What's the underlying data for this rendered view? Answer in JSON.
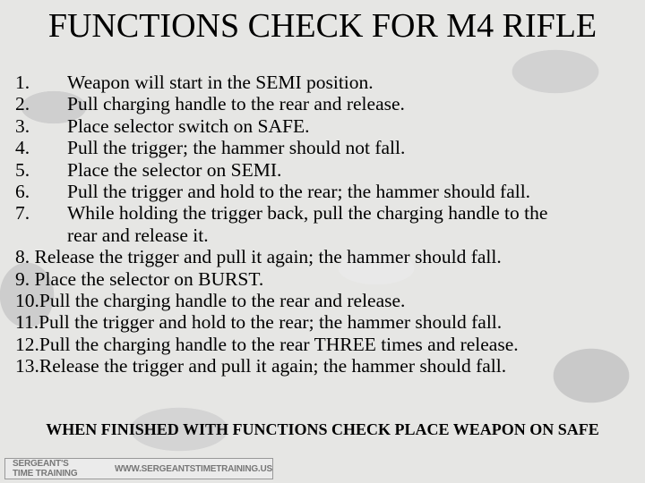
{
  "title": "FUNCTIONS CHECK FOR M4 RIFLE",
  "steps": [
    {
      "n": "1.",
      "t": "Weapon will start in the SEMI position."
    },
    {
      "n": "2.",
      "t": "Pull charging handle to the rear and release."
    },
    {
      "n": "3.",
      "t": "Place selector switch on SAFE."
    },
    {
      "n": "4.",
      "t": "Pull the trigger; the hammer should not fall."
    },
    {
      "n": "5.",
      "t": "Place the selector on SEMI."
    },
    {
      "n": "6.",
      "t": "Pull the trigger and hold to the rear; the hammer should fall."
    },
    {
      "n": "7.",
      "t": "While holding the trigger back, pull the charging handle to the",
      "t2": "rear and release it."
    },
    {
      "n": "8.",
      "t": "Release the trigger and pull it again; the hammer should fall."
    },
    {
      "n": "9.",
      "t": "Place the selector on BURST."
    },
    {
      "n": "10.",
      "t": "Pull the charging handle to the rear and release."
    },
    {
      "n": "11.",
      "t": "Pull the trigger and hold to the rear; the hammer should fall."
    },
    {
      "n": "12.",
      "t": "Pull the charging handle to the rear THREE times and release."
    },
    {
      "n": "13.",
      "t": "Release the trigger and pull it again; the hammer should fall."
    }
  ],
  "notice": "WHEN FINISHED WITH FUNCTIONS CHECK PLACE WEAPON ON SAFE",
  "banner": {
    "left": "SERGEANT'S TIME TRAINING",
    "right": "WWW.SERGEANTSTIMETRAINING.US"
  }
}
